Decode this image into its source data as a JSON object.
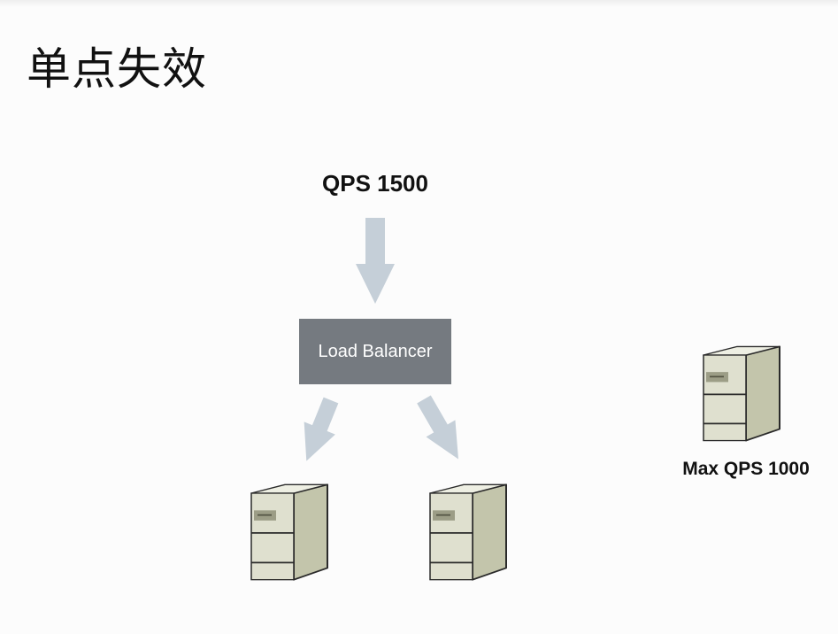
{
  "slide": {
    "title": "单点失效"
  },
  "diagram": {
    "incoming_label": "QPS 1500",
    "load_balancer_label": "Load Balancer",
    "spare_server_label": "Max QPS 1000",
    "colors": {
      "arrow": "#c5cfd8",
      "load_balancer": "#757a80",
      "server_front": "#dfe0cf",
      "server_side": "#c3c5ab",
      "server_top": "#eeefe3",
      "server_outline": "#2a2a2a",
      "server_badge": "#9c9d86"
    },
    "icons": [
      "down-arrow-icon",
      "down-left-arrow-icon",
      "down-right-arrow-icon",
      "server-icon"
    ]
  }
}
